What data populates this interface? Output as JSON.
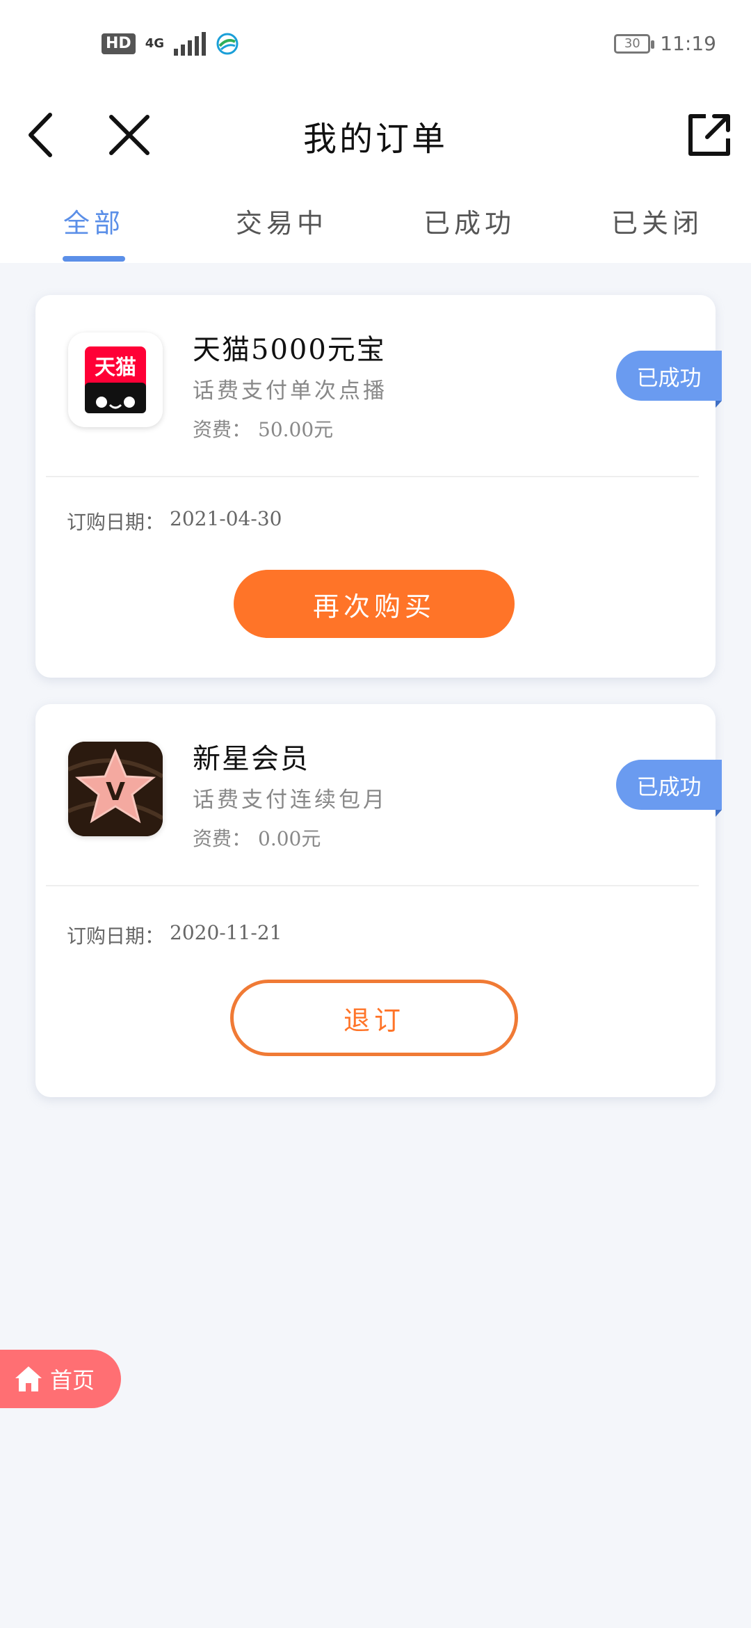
{
  "status_bar": {
    "hd": "HD",
    "network": "4G",
    "battery": "30",
    "time": "11:19"
  },
  "header": {
    "title": "我的订单"
  },
  "tabs": [
    {
      "label": "全部",
      "active": true
    },
    {
      "label": "交易中",
      "active": false
    },
    {
      "label": "已成功",
      "active": false
    },
    {
      "label": "已关闭",
      "active": false
    }
  ],
  "orders": [
    {
      "name": "天猫5000元宝",
      "icon": "tmall-icon",
      "icon_text": "天猫",
      "desc": "话费支付单次点播",
      "fee_label": "资费：",
      "fee_value": "50.00元",
      "status": "已成功",
      "date_label": "订购日期：",
      "date": "2021-04-30",
      "action": "再次购买"
    },
    {
      "name": "新星会员",
      "icon": "star-v-icon",
      "icon_text": "V",
      "desc": "话费支付连续包月",
      "fee_label": "资费：",
      "fee_value": "0.00元",
      "status": "已成功",
      "date_label": "订购日期：",
      "date": "2020-11-21",
      "action": "退订"
    }
  ],
  "home": {
    "label": "首页"
  },
  "colors": {
    "accent": "#5b8fe8",
    "badge": "#6a9bf0",
    "orange": "#ff7428",
    "home": "#ff6f73"
  }
}
